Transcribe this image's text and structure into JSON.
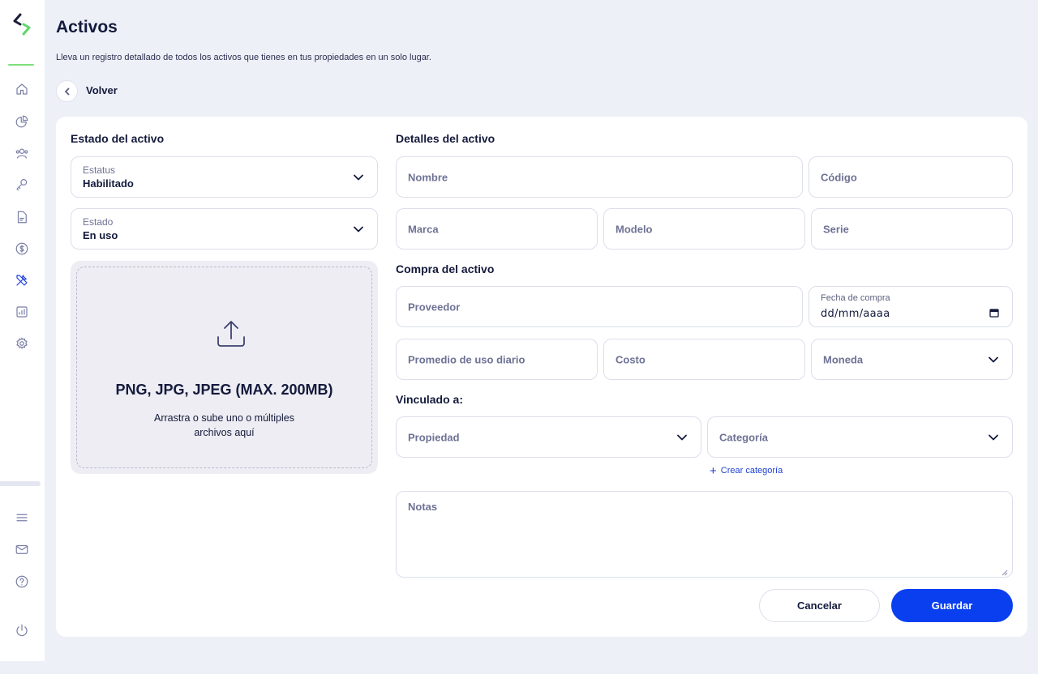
{
  "header": {
    "title": "Activos",
    "subtitle": "Lleva un registro detallado de todos los activos que tienes en tus propiedades en un solo lugar.",
    "back_label": "Volver"
  },
  "sidebar": {
    "items": [
      {
        "icon": "home-icon"
      },
      {
        "icon": "pie-chart-icon"
      },
      {
        "icon": "users-icon"
      },
      {
        "icon": "key-icon"
      },
      {
        "icon": "document-icon"
      },
      {
        "icon": "dollar-icon"
      },
      {
        "icon": "tools-icon",
        "active": true
      },
      {
        "icon": "report-icon"
      },
      {
        "icon": "settings-icon"
      }
    ],
    "bottom_items": [
      {
        "icon": "menu-icon"
      },
      {
        "icon": "mail-icon"
      },
      {
        "icon": "help-icon"
      },
      {
        "icon": "power-icon"
      }
    ]
  },
  "estado_section": {
    "title": "Estado del activo",
    "estatus": {
      "label": "Estatus",
      "value": "Habilitado"
    },
    "estado": {
      "label": "Estado",
      "value": "En uso"
    }
  },
  "upload": {
    "formats": "PNG, JPG, JPEG (MAX. 200MB)",
    "hint": "Arrastra o sube uno o múltiples archivos aquí"
  },
  "detalles_section": {
    "title": "Detalles del activo",
    "nombre_placeholder": "Nombre",
    "codigo_placeholder": "Código",
    "marca_placeholder": "Marca",
    "modelo_placeholder": "Modelo",
    "serie_placeholder": "Serie"
  },
  "compra_section": {
    "title": "Compra del activo",
    "proveedor_placeholder": "Proveedor",
    "fecha_label": "Fecha de compra",
    "fecha_value": "dd/mm/aaaa",
    "promedio_placeholder": "Promedio de uso diario",
    "costo_placeholder": "Costo",
    "moneda_placeholder": "Moneda"
  },
  "vinculado_section": {
    "title": "Vinculado a:",
    "propiedad_placeholder": "Propiedad",
    "categoria_placeholder": "Categoría",
    "create_category": "Crear categoría"
  },
  "notes": {
    "placeholder": "Notas"
  },
  "actions": {
    "cancel": "Cancelar",
    "save": "Guardar"
  },
  "colors": {
    "primary": "#0a3ff0",
    "accent_green": "#7ee07a",
    "background": "#eef0f8"
  }
}
